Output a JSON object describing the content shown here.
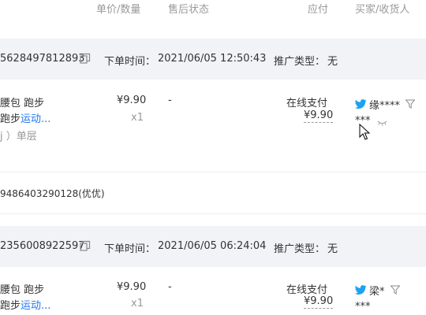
{
  "header": {
    "col_price_qty": "单价/数量",
    "col_after_sale": "售后状态",
    "col_paid": "应付",
    "col_buyer": "买家/收货人"
  },
  "orders": [
    {
      "order_id": "5628497812893",
      "time_label": "下单时间：",
      "time_value": "2021/06/05 12:50:43",
      "promo_label": "推广类型：",
      "promo_value": "无",
      "item_title_1": "腰包 跑步",
      "item_title_2a": "跑步",
      "item_title_2b": "运动...",
      "item_spec": "j ）单层",
      "unit_price": "¥9.90",
      "quantity": "x1",
      "after_sale": "-",
      "pay_method": "在线支付",
      "paid_amount": "¥9.90",
      "buyer_name": "缘****",
      "receiver_masked": "***",
      "extra_note": "9486403290128(优优)"
    },
    {
      "order_id": "2356008922597",
      "time_label": "下单时间：",
      "time_value": "2021/06/05 06:24:04",
      "promo_label": "推广类型：",
      "promo_value": "无",
      "item_title_1": "腰包 跑步",
      "item_title_2a": "跑步",
      "item_title_2b": "运动...",
      "unit_price": "¥9.90",
      "quantity": "x1",
      "after_sale": "-",
      "pay_method": "在线支付",
      "paid_amount": "¥9.90",
      "buyer_name": "梁*",
      "receiver_masked": "***"
    }
  ],
  "colors": {
    "link": "#1f76f5",
    "bar_bg": "#f2f3f7",
    "muted": "#999999",
    "text": "#333333"
  }
}
